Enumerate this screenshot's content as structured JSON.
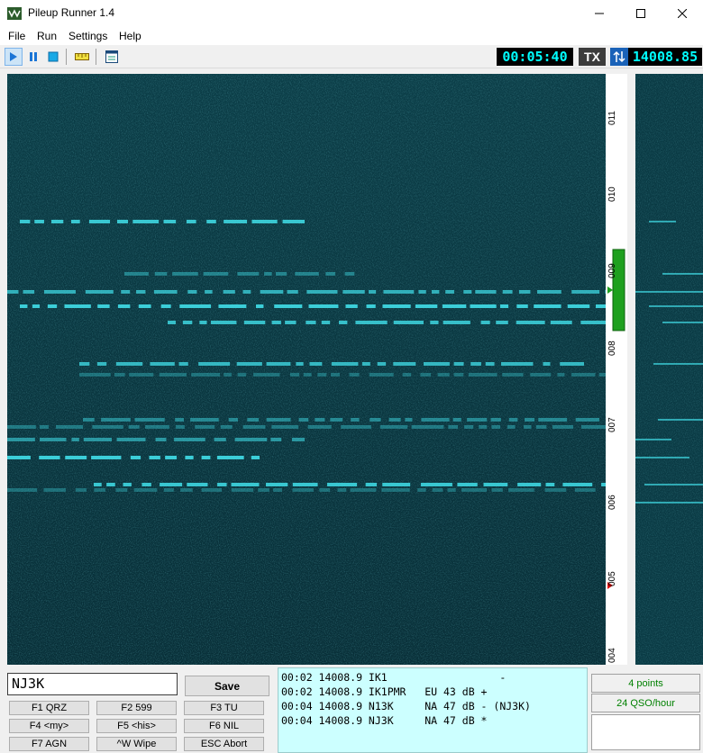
{
  "window": {
    "title": "Pileup Runner 1.4"
  },
  "menu": [
    "File",
    "Run",
    "Settings",
    "Help"
  ],
  "toolbar": {
    "buttons": [
      "play-icon",
      "pause-icon",
      "stop-icon",
      "ruler-icon",
      "window-icon"
    ]
  },
  "status": {
    "time": "00:05:40",
    "tx": "TX",
    "frequency": "14008.85"
  },
  "scale": {
    "labels": [
      "011",
      "010",
      "009",
      "008",
      "007",
      "006",
      "005",
      "004"
    ]
  },
  "entry": {
    "call_value": "NJ3K",
    "save_label": "Save"
  },
  "fkeys": [
    "F1 QRZ",
    "F2 599",
    "F3 TU",
    "F4 <my>",
    "F5 <his>",
    "F6 NIL",
    "F7 AGN",
    "^W  Wipe",
    "ESC  Abort"
  ],
  "log": {
    "rows": [
      "00:02 14008.9 IK1                  -",
      "00:02 14008.9 IK1PMR   EU 43 dB +",
      "00:04 14008.9 N13K     NA 47 dB - (NJ3K)",
      "00:04 14008.9 NJ3K     NA 47 dB *"
    ]
  },
  "stats": {
    "points": "4 points",
    "rate": "24 QSO/hour"
  },
  "colors": {
    "waterfall_bg": "#0b3a44",
    "signal": "#3ed6e0",
    "lcd_text": "#00ffff",
    "log_bg": "#ccffff",
    "stats_text": "#008000"
  }
}
